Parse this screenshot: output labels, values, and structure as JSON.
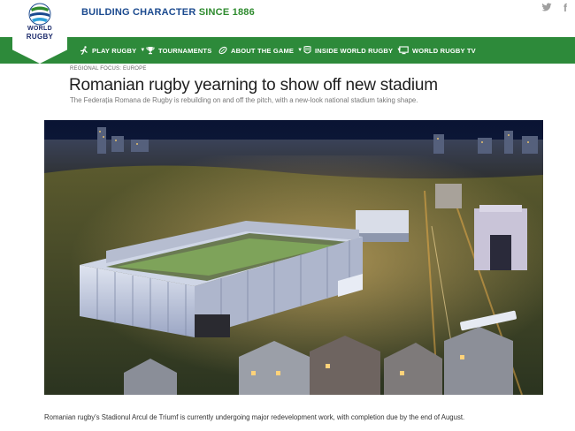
{
  "header": {
    "logo_line1": "WORLD",
    "logo_line2": "RUGBY",
    "tagline_main": "BUILDING CHARACTER ",
    "tagline_since": "SINCE 1886",
    "social": {
      "twitter_glyph": "🐦",
      "facebook_glyph": "f"
    }
  },
  "nav": [
    {
      "label": "PLAY RUGBY",
      "icon": "runner-icon",
      "dropdown": true
    },
    {
      "label": "TOURNAMENTS",
      "icon": "trophy-icon",
      "dropdown": false
    },
    {
      "label": "ABOUT THE GAME",
      "icon": "rugby-ball-icon",
      "dropdown": true
    },
    {
      "label": "INSIDE WORLD RUGBY",
      "icon": "world-rugby-logo-icon",
      "dropdown": true
    },
    {
      "label": "WORLD RUGBY TV",
      "icon": "tv-icon",
      "dropdown": false
    }
  ],
  "article": {
    "category": "REGIONAL FOCUS: EUROPE",
    "title": "Romanian rugby yearning to show off new stadium",
    "subtitle": "The Federația Romana de Rugby is rebuilding on and off the pitch, with a new-look national stadium taking shape.",
    "hero_alt": "Night-time rendering of the redeveloped stadium",
    "body_first_line": "Romanian rugby's Stadionul Arcul de Triumf is currently undergoing major redevelopment work, with completion due by the end of August."
  },
  "colors": {
    "nav_green": "#2d8a3a",
    "brand_blue": "#1b4a8f",
    "brand_green": "#2e8b2e"
  }
}
